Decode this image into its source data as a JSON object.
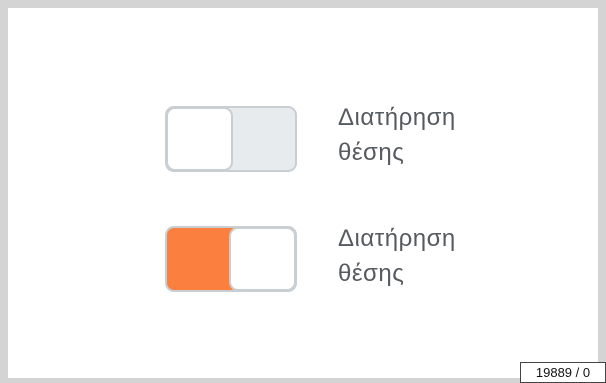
{
  "toggles": [
    {
      "label_line1": "Διατήρηση",
      "label_line2": "θέσης",
      "state": "off"
    },
    {
      "label_line1": "Διατήρηση",
      "label_line2": "θέσης",
      "state": "on"
    }
  ],
  "colors": {
    "on_color": "#fb7f3f",
    "off_track": "#e7ebee",
    "border": "#c9ced2",
    "text": "#555b61"
  },
  "image_id": "19889 / 0"
}
